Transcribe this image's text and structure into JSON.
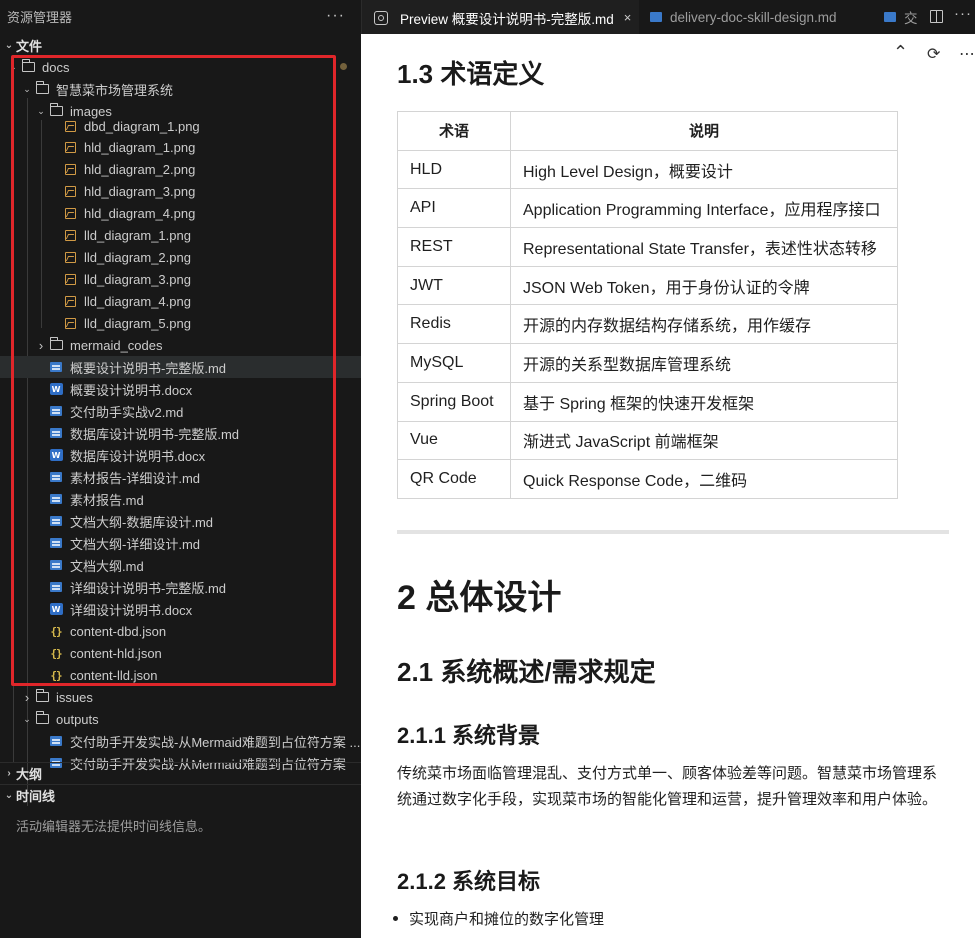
{
  "explorer": {
    "title": "资源管理器",
    "more_label": "···",
    "files_section": "文件",
    "outline_section": "大纲",
    "timeline_section": "时间线",
    "timeline_empty": "活动编辑器无法提供时间线信息。",
    "tree": [
      {
        "name": "docs",
        "type": "folder",
        "expanded": true,
        "modified": true
      },
      {
        "name": "智慧菜市场管理系统",
        "type": "folder",
        "expanded": true
      },
      {
        "name": "images",
        "type": "folder",
        "expanded": true
      },
      {
        "name": "dbd_diagram_1.png",
        "type": "image"
      },
      {
        "name": "hld_diagram_1.png",
        "type": "image"
      },
      {
        "name": "hld_diagram_2.png",
        "type": "image"
      },
      {
        "name": "hld_diagram_3.png",
        "type": "image"
      },
      {
        "name": "hld_diagram_4.png",
        "type": "image"
      },
      {
        "name": "lld_diagram_1.png",
        "type": "image"
      },
      {
        "name": "lld_diagram_2.png",
        "type": "image"
      },
      {
        "name": "lld_diagram_3.png",
        "type": "image"
      },
      {
        "name": "lld_diagram_4.png",
        "type": "image"
      },
      {
        "name": "lld_diagram_5.png",
        "type": "image"
      },
      {
        "name": "mermaid_codes",
        "type": "folder",
        "expanded": false
      },
      {
        "name": "概要设计说明书-完整版.md",
        "type": "md",
        "selected": true
      },
      {
        "name": "概要设计说明书.docx",
        "type": "docx"
      },
      {
        "name": "交付助手实战v2.md",
        "type": "md"
      },
      {
        "name": "数据库设计说明书-完整版.md",
        "type": "md"
      },
      {
        "name": "数据库设计说明书.docx",
        "type": "docx"
      },
      {
        "name": "素材报告-详细设计.md",
        "type": "md"
      },
      {
        "name": "素材报告.md",
        "type": "md"
      },
      {
        "name": "文档大纲-数据库设计.md",
        "type": "md"
      },
      {
        "name": "文档大纲-详细设计.md",
        "type": "md"
      },
      {
        "name": "文档大纲.md",
        "type": "md"
      },
      {
        "name": "详细设计说明书-完整版.md",
        "type": "md"
      },
      {
        "name": "详细设计说明书.docx",
        "type": "docx"
      },
      {
        "name": "content-dbd.json",
        "type": "json"
      },
      {
        "name": "content-hld.json",
        "type": "json"
      },
      {
        "name": "content-lld.json",
        "type": "json"
      },
      {
        "name": "issues",
        "type": "folder",
        "expanded": false
      },
      {
        "name": "outputs",
        "type": "folder",
        "expanded": true
      },
      {
        "name": "交付助手开发实战-从Mermaid难题到占位符方案 ...",
        "type": "md"
      },
      {
        "name": "交付助手开发实战-从Mermaid难题到占位符方案",
        "type": "md"
      }
    ]
  },
  "tabs": {
    "active": "Preview 概要设计说明书-完整版.md",
    "close": "×",
    "second": "delivery-doc-skill-design.md",
    "third": "交",
    "more": "···"
  },
  "toolbar": {
    "collapse_icon": "chevron-up-icon",
    "refresh_icon": "refresh-icon",
    "more_icon": "more-icon"
  },
  "doc": {
    "h_terms": "1.3 术语定义",
    "table_headers": [
      "术语",
      "说明"
    ],
    "table_rows": [
      [
        "HLD",
        "High Level Design，概要设计"
      ],
      [
        "API",
        "Application Programming Interface，应用程序接口"
      ],
      [
        "REST",
        "Representational State Transfer，表述性状态转移"
      ],
      [
        "JWT",
        "JSON Web Token，用于身份认证的令牌"
      ],
      [
        "Redis",
        "开源的内存数据结构存储系统，用作缓存"
      ],
      [
        "MySQL",
        "开源的关系型数据库管理系统"
      ],
      [
        "Spring Boot",
        "基于 Spring 框架的快速开发框架"
      ],
      [
        "Vue",
        "渐进式 JavaScript 前端框架"
      ],
      [
        "QR Code",
        "Quick Response Code，二维码"
      ]
    ],
    "h_overall": "2 总体设计",
    "h_overview": "2.1 系统概述/需求规定",
    "h_background": "2.1.1 系统背景",
    "background_text": "传统菜市场面临管理混乱、支付方式单一、顾客体验差等问题。智慧菜市场管理系统通过数字化手段，实现菜市场的智能化管理和运营，提升管理效率和用户体验。",
    "h_goals": "2.1.2 系统目标",
    "goal_1": "实现商户和摊位的数字化管理"
  },
  "colors": {
    "highlight_box": "#e0262a",
    "sidebar_bg": "#181818",
    "editor_bg": "#ffffff"
  }
}
